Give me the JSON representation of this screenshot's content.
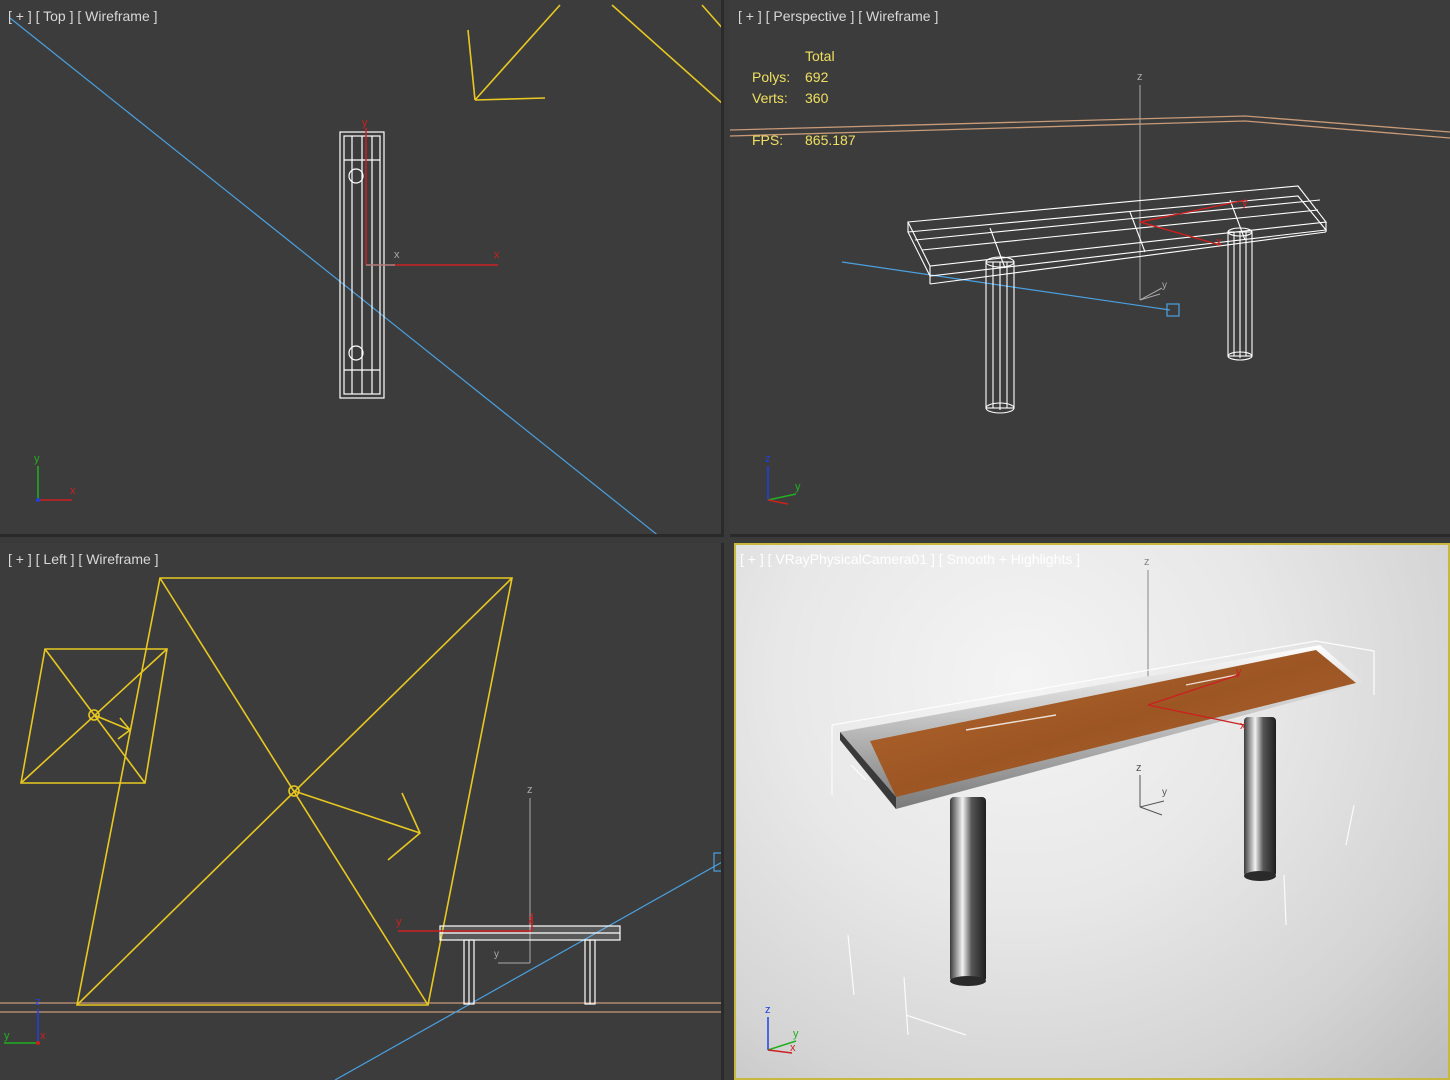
{
  "viewports": {
    "top": {
      "label": "[ + ] [ Top ] [ Wireframe ]"
    },
    "perspective": {
      "label": "[ + ] [ Perspective ] [ Wireframe ]"
    },
    "left": {
      "label": "[ + ] [ Left ] [ Wireframe ]"
    },
    "camera": {
      "label": "[ + ] [ VRayPhysicalCamera01 ] [ Smooth + Highlights ]"
    }
  },
  "stats": {
    "header": "Total",
    "polys_label": "Polys:",
    "polys_value": "692",
    "verts_label": "Verts:",
    "verts_value": "360",
    "fps_label": "FPS:",
    "fps_value": "865.187"
  },
  "axes": {
    "x": "x",
    "y": "y",
    "z": "z"
  },
  "colors": {
    "viewport_bg": "#3c3c3c",
    "active_border": "#c8b840",
    "light_yellow": "#e8c820",
    "camera_line_blue": "#4aa0e0",
    "axis_red": "#cc2020",
    "axis_green": "#20b020",
    "axis_blue": "#2040e0",
    "wood": "#a0582a"
  },
  "icons": [
    "axis-tripod-icon",
    "light-icon",
    "camera-icon",
    "transform-gizmo-icon"
  ]
}
